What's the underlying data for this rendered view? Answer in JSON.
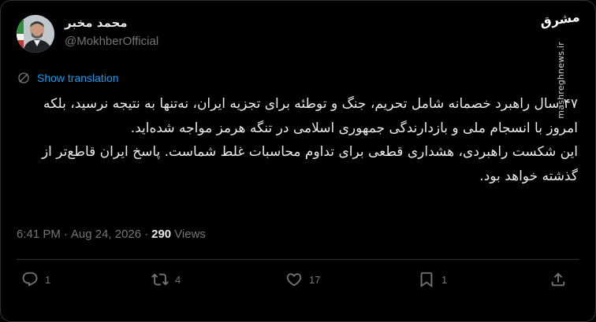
{
  "author": {
    "name": "محمد مخبر",
    "handle": "@MokhberOfficial"
  },
  "watermark": {
    "logo": "مشرق",
    "site": "mashreghnews.ir"
  },
  "translation": {
    "label": "Show translation"
  },
  "tweet": {
    "lines": [
      "۴۷ سال راهبرد خصمانه شامل تحریم، جنگ و توطئه برای تجزیه ایران، نه‌تنها به نتیجه نرسید، بلکه امروز با انسجام ملی و بازدارندگی جمهوری اسلامی در تنگه هرمز مواجه شده‌اید.",
      "این شکست راهبردی، هشداری قطعی برای تداوم محاسبات غلط شماست. پاسخ ایران قاطع‌تر از گذشته خواهد بود."
    ]
  },
  "meta": {
    "time": "6:41 PM",
    "separator": "·",
    "date": "Aug 24, 2026",
    "views_count": "290",
    "views_label": "Views"
  },
  "actions": {
    "reply_count": "1",
    "retweet_count": "4",
    "like_count": "17",
    "bookmark_count": "1"
  },
  "colors": {
    "background": "#000000",
    "text": "#e7e9ea",
    "muted": "#71767b",
    "link": "#1d9bf0",
    "border": "#2f3336"
  }
}
